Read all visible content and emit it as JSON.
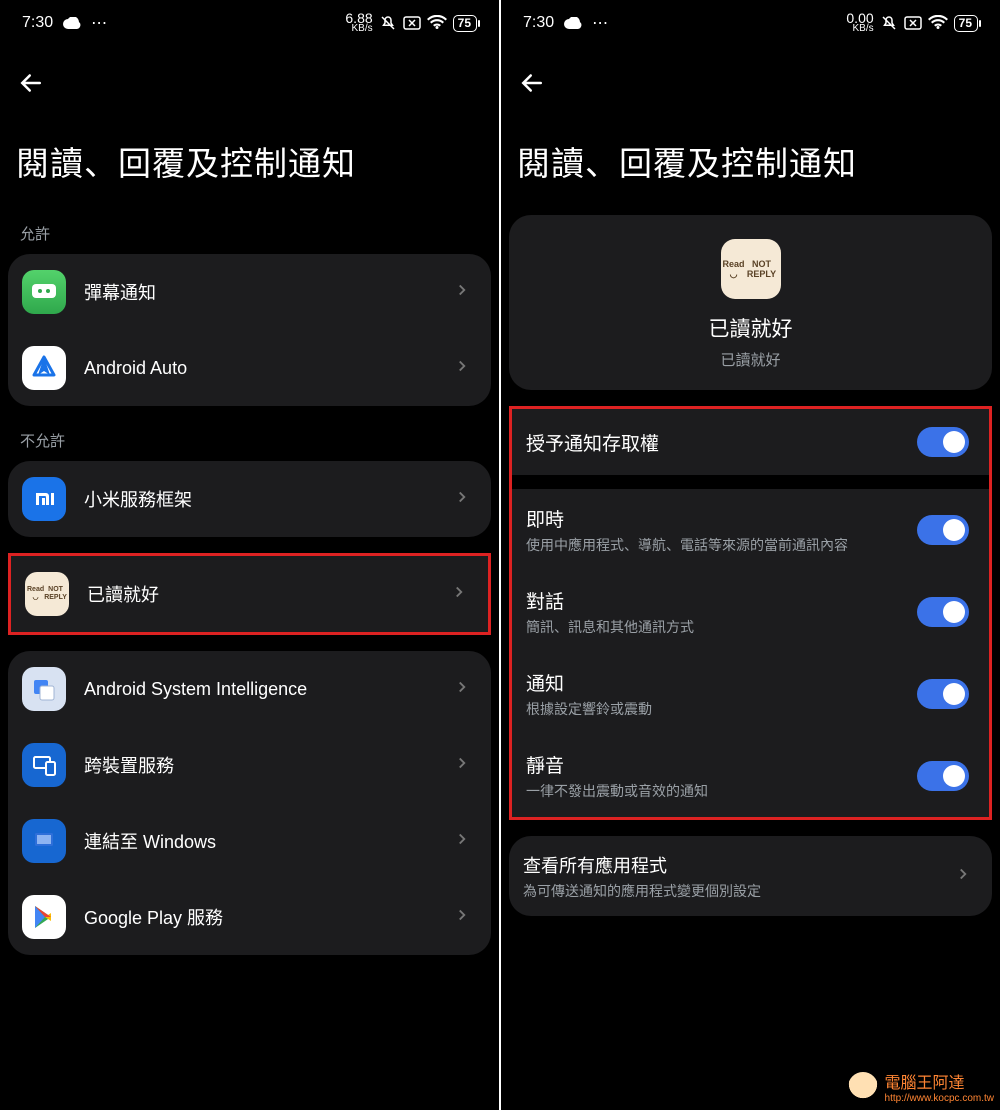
{
  "left": {
    "status": {
      "time": "7:30",
      "speed_n": "6.88",
      "speed_u": "KB/s",
      "batt": "75"
    },
    "title": "閱讀、回覆及控制通知",
    "section_allowed": "允許",
    "section_notallowed": "不允許",
    "allowed": [
      {
        "label": "彈幕通知"
      },
      {
        "label": "Android Auto"
      }
    ],
    "notallowed_top": [
      {
        "label": "小米服務框架"
      }
    ],
    "highlighted": {
      "label": "已讀就好",
      "icon_line1": "Read ◡",
      "icon_line2": "NOT REPLY"
    },
    "notallowed_rest": [
      {
        "label": "Android System Intelligence"
      },
      {
        "label": "跨裝置服務"
      },
      {
        "label": "連結至 Windows"
      },
      {
        "label": "Google Play 服務"
      }
    ]
  },
  "right": {
    "status": {
      "time": "7:30",
      "speed_n": "0.00",
      "speed_u": "KB/s",
      "batt": "75"
    },
    "title": "閱讀、回覆及控制通知",
    "app": {
      "name": "已讀就好",
      "sub": "已讀就好",
      "icon_line1": "Read ◡",
      "icon_line2": "NOT REPLY"
    },
    "grant": "授予通知存取權",
    "toggles": [
      {
        "label": "即時",
        "sub": "使用中應用程式、導航、電話等來源的當前通訊內容"
      },
      {
        "label": "對話",
        "sub": "簡訊、訊息和其他通訊方式"
      },
      {
        "label": "通知",
        "sub": "根據設定響鈴或震動"
      },
      {
        "label": "靜音",
        "sub": "一律不發出震動或音效的通知"
      }
    ],
    "see_all": {
      "label": "查看所有應用程式",
      "sub": "為可傳送通知的應用程式變更個別設定"
    }
  },
  "watermark": {
    "text": "電腦王阿達",
    "url": "http://www.kocpc.com.tw"
  }
}
